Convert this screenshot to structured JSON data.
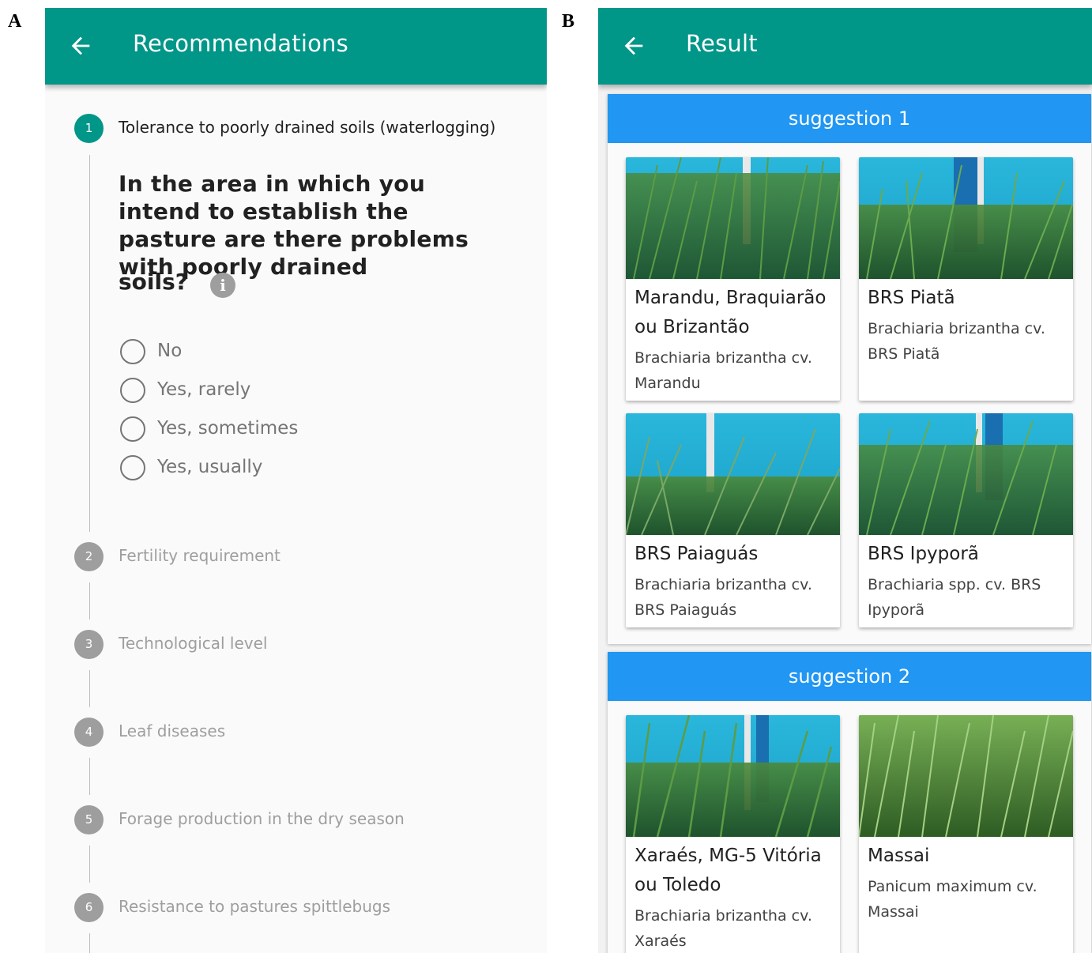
{
  "panel_labels": {
    "a": "A",
    "b": "B"
  },
  "panel_a": {
    "app_bar": {
      "title": "Recommendations",
      "back_icon": "arrow-back-icon"
    },
    "steps": [
      {
        "number": "1",
        "title": "Tolerance to poorly drained soils (waterlogging)",
        "active": true
      },
      {
        "number": "2",
        "title": "Fertility requirement",
        "active": false
      },
      {
        "number": "3",
        "title": "Technological level",
        "active": false
      },
      {
        "number": "4",
        "title": "Leaf diseases",
        "active": false
      },
      {
        "number": "5",
        "title": "Forage production in the dry season",
        "active": false
      },
      {
        "number": "6",
        "title": "Resistance to pastures spittlebugs",
        "active": false
      }
    ],
    "question": {
      "text": "In the area in which you intend to establish the pasture are there problems with poorly drained",
      "tail": "soils?",
      "info_icon": "info-icon"
    },
    "options": [
      "No",
      "Yes, rarely",
      "Yes, sometimes",
      "Yes, usually"
    ]
  },
  "panel_b": {
    "app_bar": {
      "title": "Result",
      "back_icon": "arrow-back-icon"
    },
    "suggestions": [
      {
        "header": "suggestion 1",
        "cards": [
          {
            "title": "Marandu, Braquiarão ou Brizantão",
            "subtitle": "Brachiaria brizantha cv. Marandu"
          },
          {
            "title": "BRS Piatã",
            "subtitle": "Brachiaria brizantha cv. BRS Piatã"
          },
          {
            "title": "BRS Paiaguás",
            "subtitle": "Brachiaria brizantha cv. BRS Paiaguás"
          },
          {
            "title": "BRS Ipyporã",
            "subtitle": "Brachiaria spp. cv. BRS Ipyporã"
          }
        ]
      },
      {
        "header": "suggestion 2",
        "cards": [
          {
            "title": "Xaraés, MG-5 Vitória ou Toledo",
            "subtitle": "Brachiaria brizantha cv. Xaraés"
          },
          {
            "title": "Massai",
            "subtitle": "Panicum maximum cv. Massai"
          }
        ]
      }
    ]
  },
  "colors": {
    "teal_primary": "#009688",
    "blue_header": "#2196f3",
    "inactive_grey": "#9e9e9e",
    "sky_background": "#1ab3d8",
    "grass_green": "#3e7d2e"
  }
}
